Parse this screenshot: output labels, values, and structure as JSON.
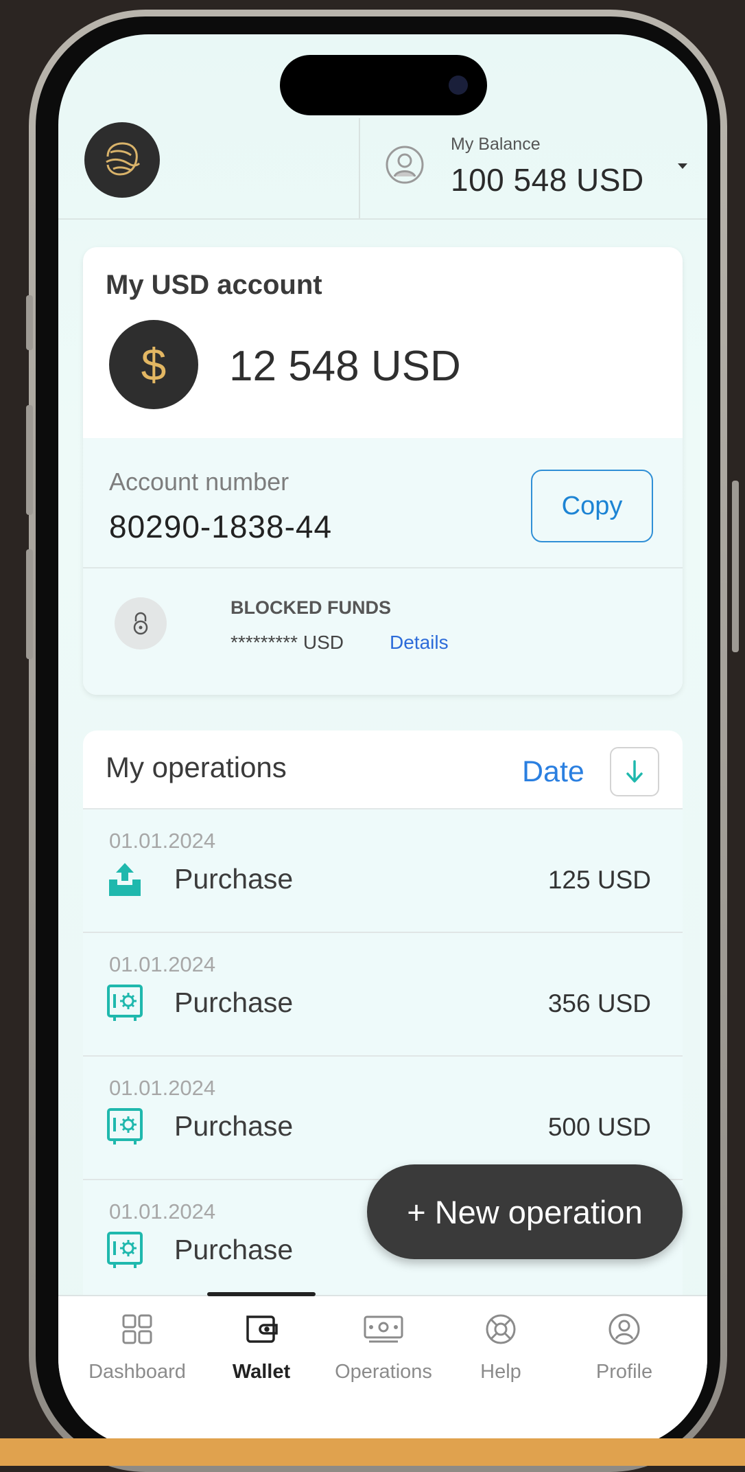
{
  "header": {
    "logo_icon": "brand-logo-icon",
    "balance_label": "My Balance",
    "balance_value": "100 548 USD",
    "avatar_icon": "user-avatar-icon",
    "caret_icon": "caret-down-icon"
  },
  "account": {
    "title": "My USD account",
    "currency_symbol": "$",
    "amount": "12 548 USD",
    "number_label": "Account number",
    "number_value": "80290-1838-44",
    "copy_label": "Copy",
    "blocked_title": "BLOCKED FUNDS",
    "blocked_value": "********* USD",
    "details_label": "Details"
  },
  "operations": {
    "title": "My operations",
    "sort_label": "Date",
    "sort_icon": "arrow-down-icon",
    "items": [
      {
        "date": "01.01.2024",
        "name": "Purchase",
        "amount": "125 USD",
        "icon": "upload-icon"
      },
      {
        "date": "01.01.2024",
        "name": "Purchase",
        "amount": "356 USD",
        "icon": "safe-icon"
      },
      {
        "date": "01.01.2024",
        "name": "Purchase",
        "amount": "500 USD",
        "icon": "safe-icon"
      },
      {
        "date": "01.01.2024",
        "name": "Purchase",
        "amount": "",
        "icon": "safe-icon"
      }
    ]
  },
  "fab": {
    "label": "+ New operation"
  },
  "nav": {
    "items": [
      {
        "label": "Dashboard",
        "icon": "grid-icon",
        "active": false
      },
      {
        "label": "Wallet",
        "icon": "wallet-icon",
        "active": true
      },
      {
        "label": "Operations",
        "icon": "banknote-icon",
        "active": false
      },
      {
        "label": "Help",
        "icon": "lifebuoy-icon",
        "active": false
      },
      {
        "label": "Profile",
        "icon": "profile-icon",
        "active": false
      }
    ]
  },
  "colors": {
    "accent_blue": "#2a7fe0",
    "teal_icon": "#1fb8ad",
    "gold": "#e3b763",
    "dark": "#2e2e2e"
  }
}
